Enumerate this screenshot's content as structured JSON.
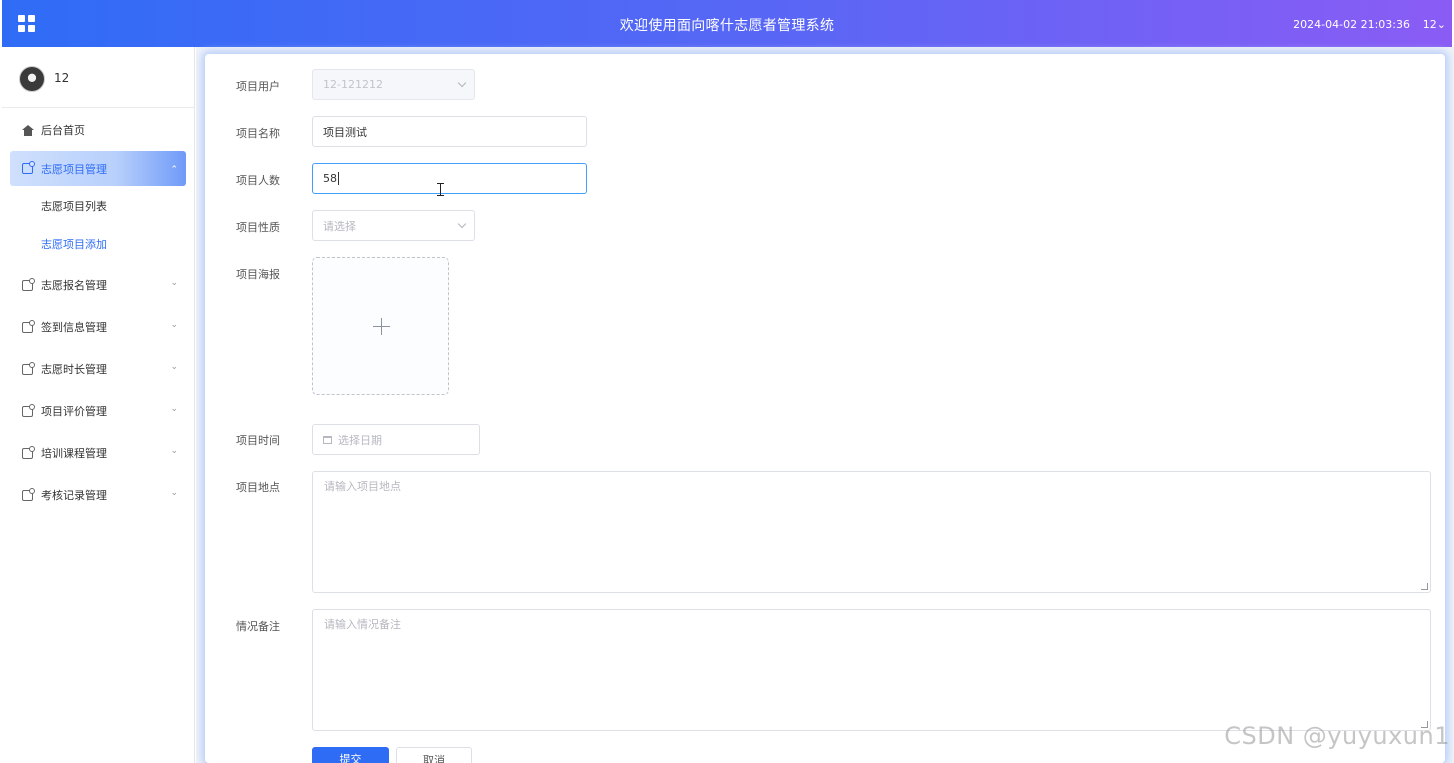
{
  "header": {
    "title": "欢迎使用面向喀什志愿者管理系统",
    "datetime": "2024-04-02 21:03:36",
    "user": "12",
    "user_caret": "⌄"
  },
  "sidebar": {
    "user_name": "12",
    "home": "后台首页",
    "groups": [
      {
        "label": "志愿项目管理",
        "expanded": true,
        "children": [
          {
            "label": "志愿项目列表"
          },
          {
            "label": "志愿项目添加",
            "current": true
          }
        ]
      },
      {
        "label": "志愿报名管理"
      },
      {
        "label": "签到信息管理"
      },
      {
        "label": "志愿时长管理"
      },
      {
        "label": "项目评价管理"
      },
      {
        "label": "培训课程管理"
      },
      {
        "label": "考核记录管理"
      }
    ],
    "chev_down": "⌄",
    "chev_up": "⌃"
  },
  "form": {
    "project_user": {
      "label": "项目用户",
      "value": "12-121212"
    },
    "project_name": {
      "label": "项目名称",
      "value": "项目测试"
    },
    "project_count": {
      "label": "项目人数",
      "value": "58"
    },
    "project_type": {
      "label": "项目性质",
      "placeholder": "请选择"
    },
    "project_poster": {
      "label": "项目海报"
    },
    "project_time": {
      "label": "项目时间",
      "placeholder": "选择日期"
    },
    "project_location": {
      "label": "项目地点",
      "placeholder": "请输入项目地点"
    },
    "remarks": {
      "label": "情况备注",
      "placeholder": "请输入情况备注"
    },
    "submit": "提交",
    "cancel": "取消"
  },
  "watermark": "CSDN @yuyuxun1",
  "colors": {
    "accent": "#2f6cf6",
    "header_end": "#8a5cf5"
  }
}
